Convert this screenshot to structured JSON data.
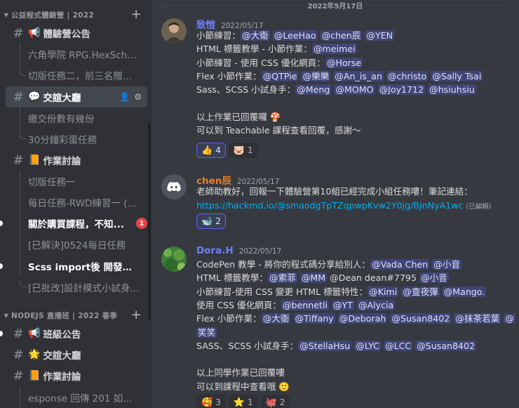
{
  "sidebar": {
    "categories": [
      {
        "label": "公益程式體驗營 | 2022"
      },
      {
        "label": "NODEJS 直播班 | 2022 春季"
      }
    ],
    "channels": [
      {
        "emoji": "📢",
        "name": "體驗營公告"
      },
      {
        "emoji": "💬",
        "name": "交誼大廳"
      },
      {
        "emoji": "📙",
        "name": "作業討論"
      },
      {
        "emoji": "📢",
        "name": "班級公告"
      },
      {
        "emoji": "🌟",
        "name": "交誼大廳"
      },
      {
        "emoji": "📙",
        "name": "作業討論"
      }
    ],
    "threads": [
      {
        "name": "六角學院 RPG.HexSchool..."
      },
      {
        "name": "切版任務二，前三名贈..."
      },
      {
        "name": "繳交份數有幾份"
      },
      {
        "name": "30分鐘彩蛋任務"
      },
      {
        "name": "切版任務一"
      },
      {
        "name": "每日任務-RWD練習一 (..."
      },
      {
        "name": "關於購買課程，不知..."
      },
      {
        "name": "[已解決]0524每日任務"
      },
      {
        "name": "Scss import後 開發者工..."
      },
      {
        "name": "[已批改]設計模式小試身..."
      },
      {
        "name": "esponse 回傳 201 如何設..."
      }
    ],
    "badge_count": "1"
  },
  "chat": {
    "date_divider": "2022年5月17日",
    "messages": [
      {
        "author": "致愷",
        "author_color": "#5865f2",
        "timestamp": "2022/05/17",
        "lines": [
          {
            "prefix": "小節練習：",
            "mentions": [
              "@大衛",
              "@LeeHao",
              "@chen辰",
              "@YEN"
            ]
          },
          {
            "prefix": "HTML 標籤教學 - 小節作業：",
            "mentions": [
              "@meimei"
            ]
          },
          {
            "prefix": "小節練習 - 使用 CSS 優化網頁：",
            "mentions": [
              "@Horse"
            ]
          },
          {
            "prefix": "Flex 小節作業：",
            "mentions": [
              "@QTPie",
              "@樂樂",
              "@An_is_an",
              "@christo",
              "@Sally Tsai"
            ]
          },
          {
            "prefix": "Sass、SCSS 小試身手：",
            "mentions": [
              "@Meng",
              "@MOMO",
              "@Joy1712",
              "@hsiuhsiu"
            ]
          }
        ],
        "closing": [
          "以上作業已回覆囉 🍄",
          "可以到 Teachable 課程查看回覆，感謝～"
        ],
        "reactions": [
          {
            "emoji": "👍",
            "count": "4",
            "me": true
          },
          {
            "emoji": "🐷",
            "count": "1",
            "me": false
          }
        ]
      },
      {
        "author": "chen辰",
        "author_color": "#e67e22",
        "timestamp": "2022/05/17",
        "text": "老師助教好，回報一下體驗營第10組已經完成小組任務嘍！筆記連結：",
        "link": "https://hackmd.io/@smaodgTpTZqpwpKvw2Y0jg/BJnNyA1wc",
        "edited": "(已編輯)",
        "reactions": [
          {
            "emoji": "🐋",
            "count": "2",
            "me": true
          }
        ]
      },
      {
        "author": "Dora.H",
        "author_color": "#5865f2",
        "timestamp": "2022/05/17",
        "lines": [
          {
            "prefix": "CodePen 教學 - 將你的程式碼分享給別人：",
            "mentions": [
              "@Vada Chen",
              "@小音"
            ]
          },
          {
            "prefix": "HTML 標籤教學：",
            "mentions": [
              "@索菲",
              "@MM"
            ],
            "plain": "@Dean dean#7795",
            "mentions2": [
              "@小音"
            ]
          },
          {
            "prefix": "小節練習-使用 CSS 變更 HTML 標籤特性：",
            "mentions": [
              "@Kimi",
              "@查夜彈",
              "@Mango."
            ]
          },
          {
            "prefix": "使用 CSS 優化網頁：",
            "mentions": [
              "@bennetli",
              "@YT",
              "@Alycia"
            ]
          },
          {
            "prefix": "Flex 小節作業：",
            "mentions": [
              "@大衛",
              "@Tiffany",
              "@Deborah",
              "@Susan8402",
              "@抹茶若葉",
              "@"
            ]
          },
          {
            "prefix": "",
            "mentions": [
              "笑笑"
            ]
          },
          {
            "prefix": "SASS、SCSS 小試身手：",
            "mentions": [
              "@StellaHsu",
              "@LYC",
              "@LCC",
              "@Susan8402"
            ]
          }
        ],
        "closing": [
          "以上同學作業已回覆嘍",
          "可以到課程中查看哦 🙂"
        ],
        "reactions": [
          {
            "emoji": "🥰",
            "count": "3",
            "me": false
          },
          {
            "emoji": "⭐",
            "count": "1",
            "me": false
          },
          {
            "emoji": "🐙",
            "count": "2",
            "me": false
          }
        ]
      }
    ]
  }
}
